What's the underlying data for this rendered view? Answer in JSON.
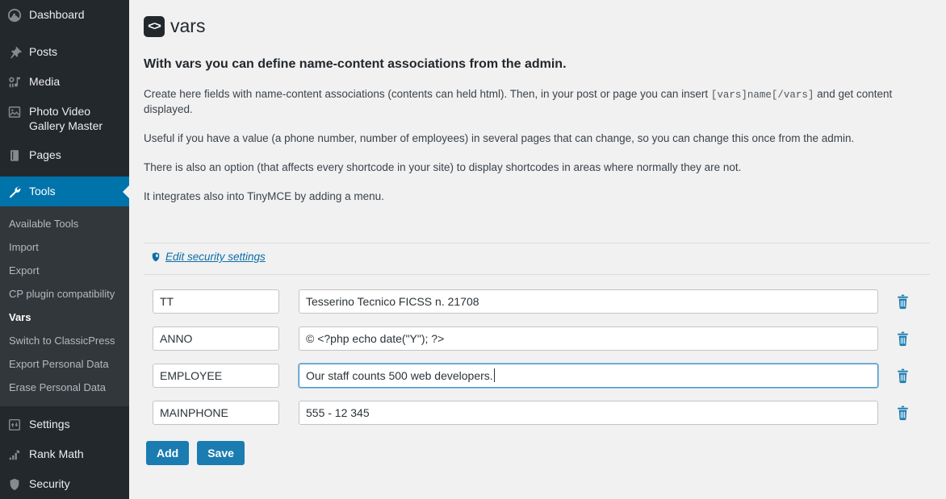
{
  "sidebar": {
    "items": [
      {
        "label": "Dashboard",
        "icon": "dashboard-icon",
        "current": false
      },
      {
        "label": "Posts",
        "icon": "pin-icon",
        "current": false
      },
      {
        "label": "Media",
        "icon": "media-icon",
        "current": false
      },
      {
        "label": "Photo Video Gallery Master",
        "icon": "gallery-icon",
        "current": false
      },
      {
        "label": "Pages",
        "icon": "pages-icon",
        "current": false
      },
      {
        "label": "Tools",
        "icon": "wrench-icon",
        "current": true
      }
    ],
    "submenu": [
      {
        "label": "Available Tools",
        "current": false
      },
      {
        "label": "Import",
        "current": false
      },
      {
        "label": "Export",
        "current": false
      },
      {
        "label": "CP plugin compatibility",
        "current": false
      },
      {
        "label": "Vars",
        "current": true
      },
      {
        "label": "Switch to ClassicPress",
        "current": false
      },
      {
        "label": "Export Personal Data",
        "current": false
      },
      {
        "label": "Erase Personal Data",
        "current": false
      }
    ],
    "items_after": [
      {
        "label": "Settings",
        "icon": "settings-icon",
        "current": false
      },
      {
        "label": "Rank Math",
        "icon": "rankmath-icon",
        "current": false
      },
      {
        "label": "Security",
        "icon": "shield-icon",
        "current": false
      }
    ],
    "colors": {
      "background": "#23282d",
      "submenu_background": "#32373c",
      "current_highlight": "#0073aa"
    }
  },
  "page": {
    "title": "vars",
    "logo_glyph": "<>",
    "lead": "With vars you can define name-content associations from the admin.",
    "paragraphs": {
      "p1_before": "Create here fields with name-content associations (contents can held html). Then, in your post or page you can insert ",
      "p1_code": "[vars]name[/vars]",
      "p1_after": " and get content displayed.",
      "p2": "Useful if you have a value (a phone number, number of employees) in several pages that can change, so you can change this once from the admin.",
      "p3": "There is also an option (that affects every shortcode in your site) to display shortcodes in areas where normally they are not.",
      "p4": "It integrates also into TinyMCE by adding a menu."
    },
    "security_link": "Edit security settings"
  },
  "form": {
    "name_placeholder": "",
    "value_placeholder": "",
    "rows": [
      {
        "name": "TT",
        "value": "Tesserino Tecnico FICSS n. 21708",
        "focused": false
      },
      {
        "name": "ANNO",
        "value": "© <?php echo date(\"Y\"); ?>",
        "focused": false
      },
      {
        "name": "EMPLOYEE",
        "value": "Our staff counts 500 web developers.",
        "focused": true
      },
      {
        "name": "MAINPHONE",
        "value": "555 - 12 345",
        "focused": false
      }
    ],
    "delete_icon": "trash-icon",
    "delete_icon_color": "#1a7cb0",
    "buttons": {
      "add": "Add",
      "save": "Save"
    },
    "button_color": "#1a7cb0"
  }
}
